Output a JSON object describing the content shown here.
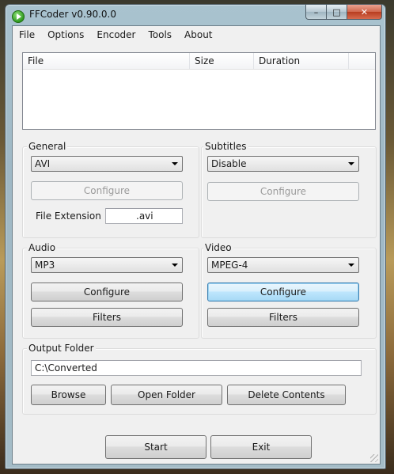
{
  "window": {
    "title": "FFCoder v0.90.0.0"
  },
  "menu": [
    "File",
    "Options",
    "Encoder",
    "Tools",
    "About"
  ],
  "file_list": {
    "columns": [
      "File",
      "Size",
      "Duration"
    ]
  },
  "general": {
    "label": "General",
    "format": "AVI",
    "configure": "Configure",
    "ext_label": "File Extension",
    "ext_value": ".avi"
  },
  "subtitles": {
    "label": "Subtitles",
    "value": "Disable",
    "configure": "Configure"
  },
  "audio": {
    "label": "Audio",
    "codec": "MP3",
    "configure": "Configure",
    "filters": "Filters"
  },
  "video": {
    "label": "Video",
    "codec": "MPEG-4",
    "configure": "Configure",
    "filters": "Filters"
  },
  "output": {
    "label": "Output Folder",
    "path": "C:\\Converted",
    "browse": "Browse",
    "open": "Open Folder",
    "delete": "Delete Contents"
  },
  "actions": {
    "start": "Start",
    "exit": "Exit"
  }
}
